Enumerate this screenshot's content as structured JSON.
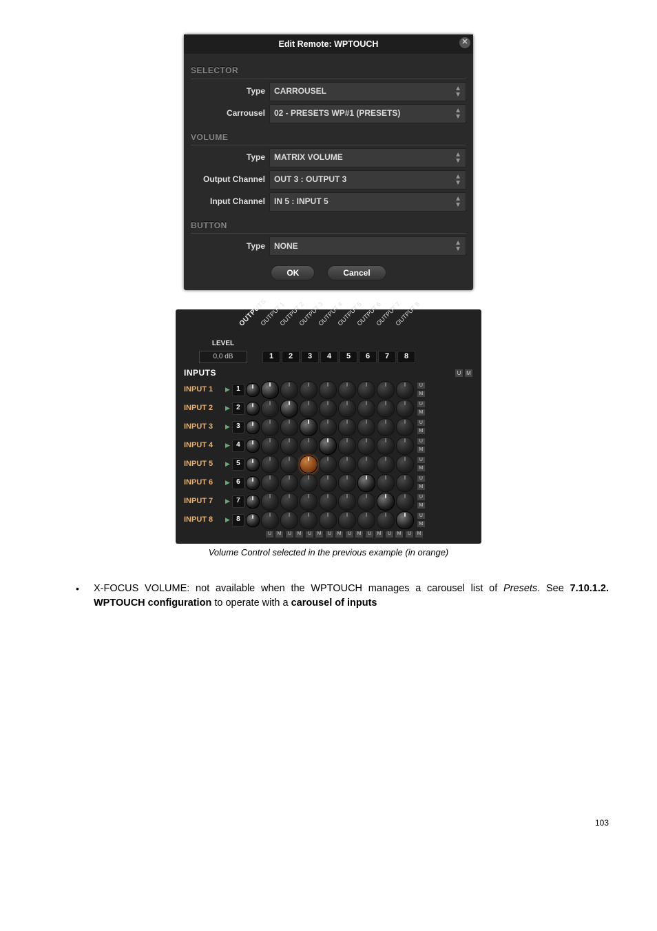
{
  "dialog": {
    "title": "Edit Remote: WPTOUCH",
    "sections": {
      "selector": {
        "heading": "SELECTOR",
        "type_label": "Type",
        "type_value": "CARROUSEL",
        "carrousel_label": "Carrousel",
        "carrousel_value": "02 - PRESETS WP#1 (PRESETS)"
      },
      "volume": {
        "heading": "VOLUME",
        "type_label": "Type",
        "type_value": "MATRIX VOLUME",
        "out_label": "Output Channel",
        "out_value": "OUT 3 : OUTPUT 3",
        "in_label": "Input Channel",
        "in_value": "IN 5 : INPUT 5"
      },
      "button": {
        "heading": "BUTTON",
        "type_label": "Type",
        "type_value": "NONE"
      }
    },
    "ok": "OK",
    "cancel": "Cancel"
  },
  "matrix": {
    "level_label": "LEVEL",
    "level_value": "0,0 dB",
    "outputs_header": "OUTPUTS",
    "output_names": [
      "OUTPUT 1",
      "OUTPUT 2",
      "OUTPUT 3",
      "OUTPUT 4",
      "OUTPUT 5",
      "OUTPUT 6",
      "OUTPUT 7",
      "OUTPUT 8"
    ],
    "inputs_header": "INPUTS",
    "u": "U",
    "m": "M",
    "input_names": [
      "INPUT 1",
      "INPUT 2",
      "INPUT 3",
      "INPUT 4",
      "INPUT 5",
      "INPUT 6",
      "INPUT 7",
      "INPUT 8"
    ],
    "selected_row": 5,
    "selected_col": 3,
    "diag_on": [
      [
        1,
        1
      ],
      [
        2,
        2
      ],
      [
        3,
        3
      ],
      [
        4,
        4
      ],
      [
        5,
        3
      ],
      [
        6,
        6
      ],
      [
        7,
        7
      ],
      [
        8,
        8
      ]
    ]
  },
  "caption": "Volume Control selected in the previous example (in orange)",
  "bullet": {
    "lead": "X-FOCUS VOLUME: not available when the WPTOUCH manages a carousel list of ",
    "presets": "Presets",
    "see": ". See ",
    "ref": "7.10.1.2. WPTOUCH configuration",
    "mid": " to operate with a ",
    "carousel": "carousel of inputs"
  },
  "page": "103"
}
